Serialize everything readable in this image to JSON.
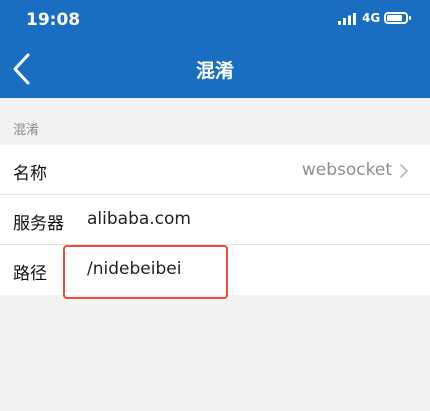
{
  "status_bar": {
    "time": "19:08",
    "network": "4G",
    "battery_level": 0.85
  },
  "nav": {
    "title": "混淆",
    "back_icon": "chevron-left-icon"
  },
  "section": {
    "label": "混淆"
  },
  "rows": {
    "name": {
      "label": "名称",
      "value": "websocket",
      "icon": "chevron-right-icon"
    },
    "server": {
      "label": "服务器",
      "value": "alibaba.com"
    },
    "path": {
      "label": "路径",
      "value": "/nidebeibei"
    }
  },
  "colors": {
    "header": "#1a6ec2",
    "background": "#f2f2f2",
    "highlight": "#e74c3c"
  }
}
